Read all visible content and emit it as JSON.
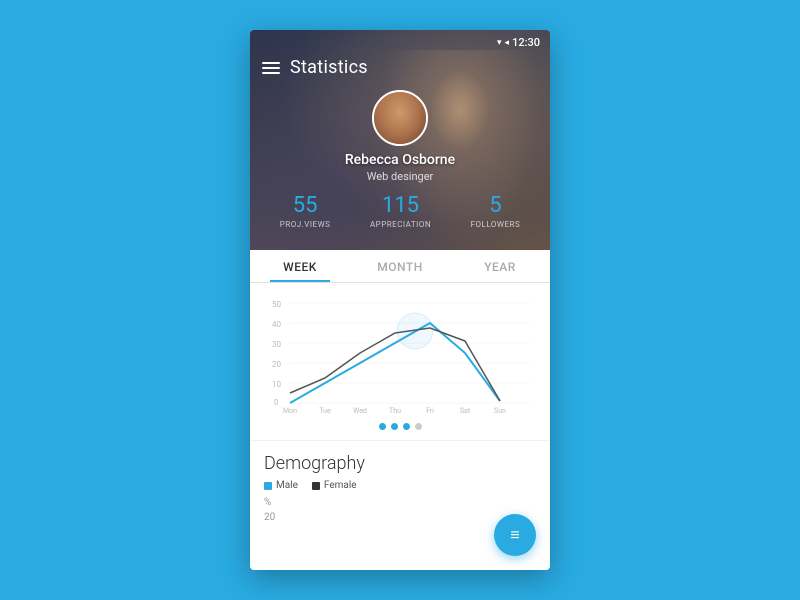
{
  "statusBar": {
    "time": "12:30",
    "signalIcon": "▾",
    "wifiIcon": "▲",
    "batteryIcon": "▮"
  },
  "header": {
    "menuIcon": "menu",
    "title": "Statistics"
  },
  "profile": {
    "name": "Rebecca Osborne",
    "role": "Web desinger",
    "avatarAlt": "Rebecca Osborne avatar"
  },
  "stats": [
    {
      "value": "55",
      "label": "PROJ.VIEWS"
    },
    {
      "value": "115",
      "label": "APPRECIATION"
    },
    {
      "value": "5",
      "label": "FOLLOWERS"
    }
  ],
  "tabs": [
    {
      "label": "WEEK",
      "active": true
    },
    {
      "label": "MONTH",
      "active": false
    },
    {
      "label": "YEAR",
      "active": false
    }
  ],
  "chart": {
    "xLabels": [
      "Mon",
      "Tue",
      "Wed",
      "Thu",
      "Fri",
      "Sat",
      "Sun"
    ],
    "yLabels": [
      "50",
      "40",
      "30",
      "20",
      "10",
      "0"
    ],
    "series": {
      "line1": "blue",
      "line2": "dark"
    },
    "dots": [
      true,
      true,
      true,
      false
    ]
  },
  "demography": {
    "title": "Demography",
    "legend": [
      {
        "label": "Male",
        "color": "male"
      },
      {
        "label": "Female",
        "color": "female"
      }
    ],
    "yLabel": "%",
    "yValue": "20"
  },
  "fab": {
    "icon": "≡",
    "label": "filter"
  }
}
